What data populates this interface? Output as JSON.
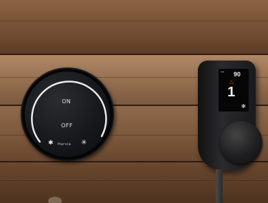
{
  "left_dial": {
    "on_label": "ON",
    "off_label": "OFF",
    "brand": "Harvia",
    "ring_color": "#e9ecef",
    "icons": [
      "snowflake-icon",
      "snowflake-icon"
    ]
  },
  "right_controller": {
    "temperature": "90",
    "power_level": "1",
    "heat_icon_color": "#ff5a1e",
    "icons": [
      "wifi-icon",
      "heat-icon",
      "fan-icon"
    ]
  }
}
